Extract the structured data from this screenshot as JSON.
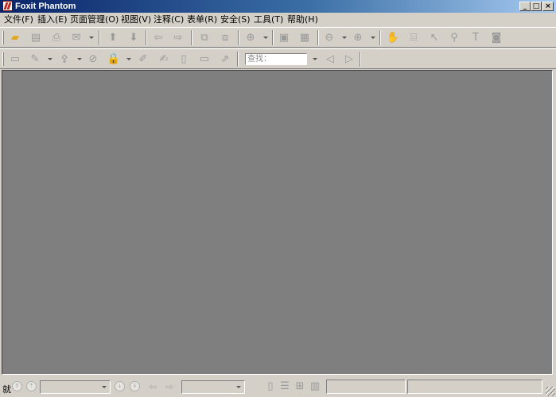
{
  "window": {
    "title": "Foxit Phantom"
  },
  "title_buttons": {
    "minimize": "_",
    "maximize": "□",
    "close": "×"
  },
  "menu": [
    {
      "label": "文件(F)"
    },
    {
      "label": "插入(E)"
    },
    {
      "label": "页面管理(O)"
    },
    {
      "label": "视图(V)"
    },
    {
      "label": "注释(C)"
    },
    {
      "label": "表单(R)"
    },
    {
      "label": "安全(S)"
    },
    {
      "label": "工具(T)"
    },
    {
      "label": "帮助(H)"
    }
  ],
  "toolbar1": [
    {
      "icon": "open-folder-icon",
      "glyph": "▰"
    },
    {
      "icon": "save-icon",
      "glyph": "▤"
    },
    {
      "icon": "print-icon",
      "glyph": "⎙"
    },
    {
      "icon": "email-icon",
      "glyph": "✉"
    },
    {
      "icon": "previous-page-icon",
      "glyph": "⬆"
    },
    {
      "icon": "next-page-icon",
      "glyph": "⬇"
    },
    {
      "icon": "back-arrow-icon",
      "glyph": "⇦"
    },
    {
      "icon": "forward-arrow-icon",
      "glyph": "⇨"
    },
    {
      "icon": "insert-page-icon",
      "glyph": "⧉"
    },
    {
      "icon": "extract-page-icon",
      "glyph": "⧈"
    },
    {
      "icon": "zoom-in-icon",
      "glyph": "⊕"
    },
    {
      "icon": "fit-page-icon",
      "glyph": "▣"
    },
    {
      "icon": "fit-width-icon",
      "glyph": "▦"
    },
    {
      "icon": "zoom-out-circle-icon",
      "glyph": "⊖"
    },
    {
      "icon": "zoom-in-circle-icon",
      "glyph": "⊕"
    },
    {
      "icon": "hand-tool-icon",
      "glyph": "✋"
    },
    {
      "icon": "select-text-icon",
      "glyph": "⌸"
    },
    {
      "icon": "select-arrow-icon",
      "glyph": "↖"
    },
    {
      "icon": "binoculars-icon",
      "glyph": "⚲"
    },
    {
      "icon": "typewriter-icon",
      "glyph": "T"
    },
    {
      "icon": "snapshot-camera-icon",
      "glyph": "◙"
    }
  ],
  "toolbar2": [
    {
      "icon": "note-icon",
      "glyph": "▭"
    },
    {
      "icon": "pencil-icon",
      "glyph": "✎"
    },
    {
      "icon": "stamp-icon",
      "glyph": "⚴"
    },
    {
      "icon": "no-image-icon",
      "glyph": "⊘"
    },
    {
      "icon": "lock-icon",
      "glyph": "🔒"
    },
    {
      "icon": "edit-document-icon",
      "glyph": "✐"
    },
    {
      "icon": "edit-text-icon",
      "glyph": "✍"
    },
    {
      "icon": "text-box-icon",
      "glyph": "▯"
    },
    {
      "icon": "comment-icon",
      "glyph": "▭"
    },
    {
      "icon": "pin-icon",
      "glyph": "⇗"
    }
  ],
  "find": {
    "placeholder": "查找："
  },
  "find_nav": [
    {
      "icon": "find-previous-icon",
      "glyph": "◁"
    },
    {
      "icon": "find-next-icon",
      "glyph": "▷"
    }
  ],
  "status": {
    "text": "就"
  },
  "statusbar_icons": {
    "first": "⇑",
    "prev": "⇡",
    "next": "⇣",
    "last": "⇓",
    "back": "⇦",
    "forward": "⇨",
    "single_page": "▯",
    "continuous": "☰",
    "facing": "⊞",
    "continuous_facing": "▥"
  }
}
